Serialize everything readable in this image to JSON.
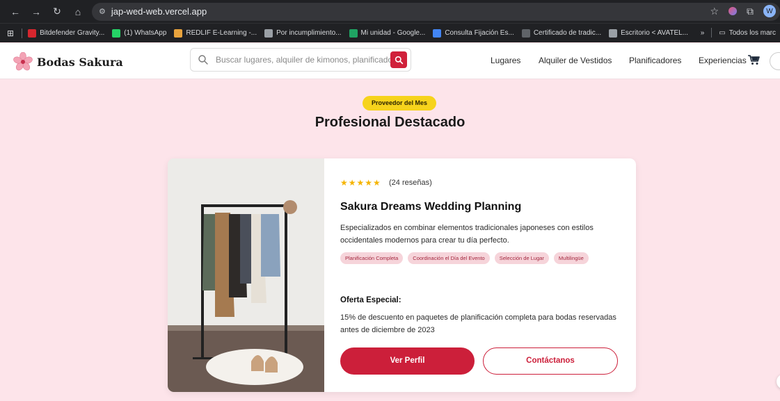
{
  "browser": {
    "url": "jap-wed-web.vercel.app",
    "profile_initial": "W"
  },
  "bookmarks": {
    "items": [
      {
        "label": "Bitdefender Gravity...",
        "icon": "bitdefender-icon",
        "color": "#d6262e"
      },
      {
        "label": "(1) WhatsApp",
        "icon": "whatsapp-icon",
        "color": "#25d366"
      },
      {
        "label": "REDLIF E-Learning -...",
        "icon": "redlif-icon",
        "color": "#e8a33d"
      },
      {
        "label": "Por incumplimiento...",
        "icon": "globe-icon",
        "color": "#9aa0a6"
      },
      {
        "label": "Mi unidad - Google...",
        "icon": "google-drive-icon",
        "color": "#1fa463"
      },
      {
        "label": "Consulta Fijación Es...",
        "icon": "consulta-icon",
        "color": "#4285f4"
      },
      {
        "label": "Certificado de tradic...",
        "icon": "certificado-icon",
        "color": "#5f6368"
      },
      {
        "label": "Escritorio < AVATEL...",
        "icon": "globe-icon",
        "color": "#9aa0a6"
      }
    ],
    "all_bookmarks": "Todos los marc"
  },
  "site": {
    "brand": "Bodas Sakura",
    "search_placeholder": "Buscar lugares, alquiler de kimonos, planificadores",
    "nav": {
      "lugares": "Lugares",
      "alquiler": "Alquiler de Vestidos",
      "planificadores": "Planificadores",
      "experiencias": "Experiencias"
    }
  },
  "featured": {
    "badge": "Proveedor del Mes",
    "heading": "Profesional Destacado",
    "stars": "★★★★★",
    "reviews": "(24 reseñas)",
    "name": "Sakura Dreams Wedding Planning",
    "description": "Especializados en combinar elementos tradicionales japoneses con estilos occidentales modernos para crear tu día perfecto.",
    "tags": [
      "Planificación Completa",
      "Coordinación el Día del Evento",
      "Selección de Lugar",
      "Multilingüe"
    ],
    "offer_title": "Oferta Especial:",
    "offer_text": "15% de descuento en paquetes de planificación completa para bodas reservadas antes de diciembre de 2023",
    "primary_button": "Ver Perfil",
    "secondary_button": "Contáctanos"
  },
  "colors": {
    "accent": "#cc1f3a",
    "background": "#fde4ea",
    "badge": "#f6d31c",
    "tag_bg": "#f6d4da"
  }
}
